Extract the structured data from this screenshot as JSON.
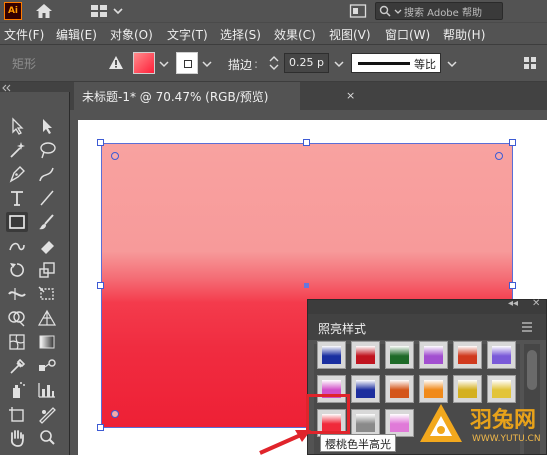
{
  "app": {
    "logo": "Ai"
  },
  "titlebar": {
    "search_placeholder": "搜索 Adobe 帮助",
    "icons": [
      "home-icon",
      "workspace-grid-icon",
      "panel-layout-icon",
      "search-icon"
    ]
  },
  "menubar": {
    "items": [
      "文件(F)",
      "编辑(E)",
      "对象(O)",
      "文字(T)",
      "选择(S)",
      "效果(C)",
      "视图(V)",
      "窗口(W)",
      "帮助(H)"
    ]
  },
  "controlbar": {
    "shape_label": "矩形",
    "stroke_label": "描边",
    "stroke_width": "0.25 p",
    "stroke_profile": "等比",
    "fill_color": "#f43b4c"
  },
  "document": {
    "tab_title": "未标题-1* @ 70.47% (RGB/预览)",
    "close": "×"
  },
  "graphic_styles_panel": {
    "title": "照亮样式",
    "tooltip": "樱桃色半高光",
    "swatches": [
      {
        "name": "blue-gloss",
        "color": "#1a2fa0"
      },
      {
        "name": "red-gloss",
        "color": "#c0141f"
      },
      {
        "name": "green-dark",
        "color": "#1e6a28"
      },
      {
        "name": "violet",
        "color": "#a24fd0"
      },
      {
        "name": "red-orange",
        "color": "#d03a1e"
      },
      {
        "name": "purple-blue",
        "color": "#7a5ad8"
      },
      {
        "name": "magenta-gloss",
        "color": "#d24fc8"
      },
      {
        "name": "navy-gloss",
        "color": "#1d2e9e"
      },
      {
        "name": "orange-red",
        "color": "#d4561b"
      },
      {
        "name": "orange-gloss",
        "color": "#f08a1a"
      },
      {
        "name": "gold-gloss",
        "color": "#d4b020"
      },
      {
        "name": "yellow-gloss",
        "color": "#e2c43a"
      },
      {
        "name": "cherry-half-highlight",
        "color": "#f02a3a"
      },
      {
        "name": "silver-gloss",
        "color": "#8a8a8a"
      },
      {
        "name": "pink-gloss",
        "color": "#e07ad8"
      }
    ]
  },
  "watermark": {
    "name": "羽兔网",
    "url": "WWW.YUTU.CN"
  }
}
